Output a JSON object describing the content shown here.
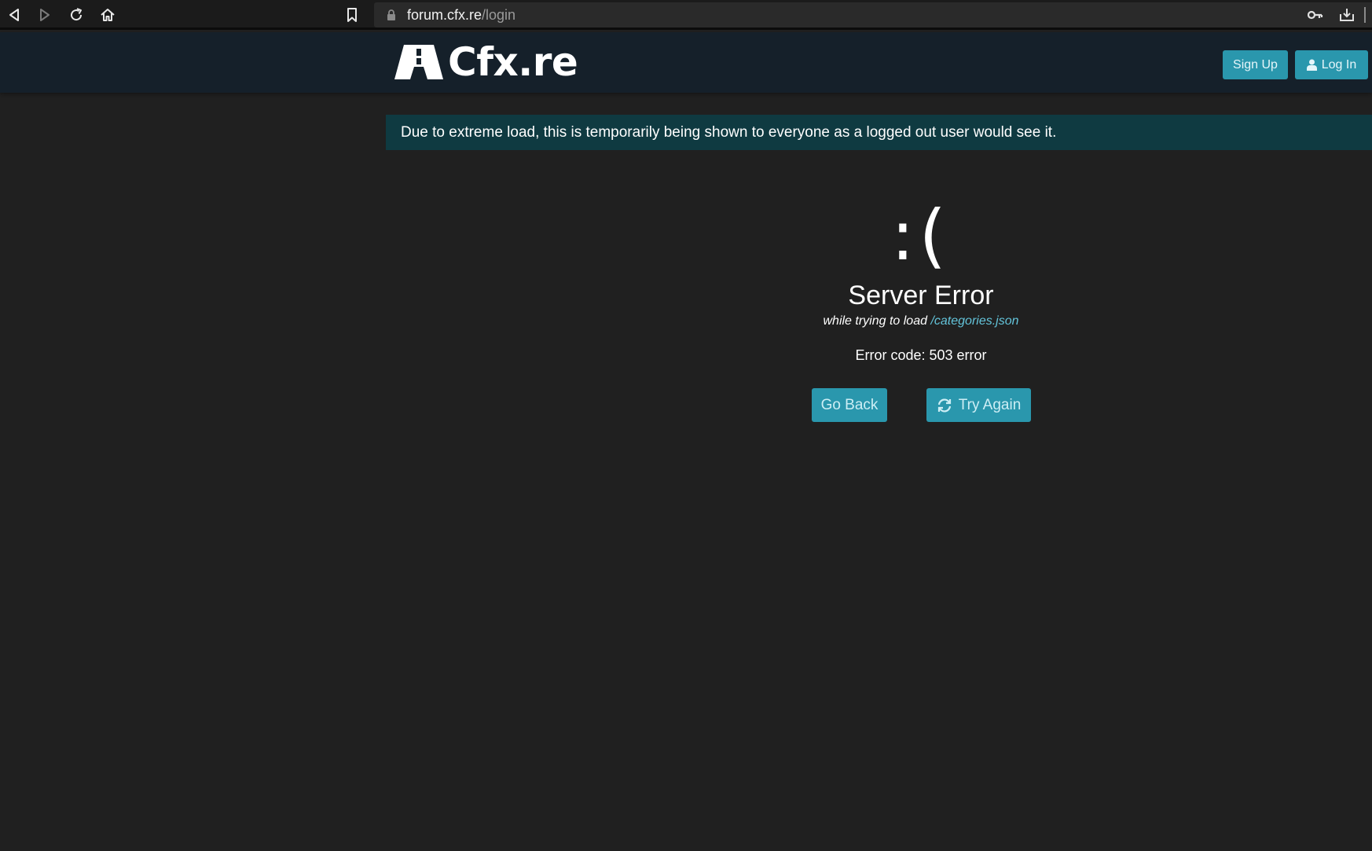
{
  "browser": {
    "url_host": "forum.cfx.re",
    "url_path": "/login",
    "icons": [
      "back-icon",
      "forward-icon",
      "reload-icon",
      "home-icon",
      "bookmark-icon",
      "lock-icon",
      "key-icon",
      "download-icon"
    ]
  },
  "header": {
    "logo_text": "Cfx.re",
    "signup_label": "Sign Up",
    "login_label": "Log In",
    "accent_color": "#2a97ad"
  },
  "banner": {
    "text": "Due to extreme load, this is temporarily being shown to everyone as a logged out user would see it."
  },
  "error": {
    "face": ":(",
    "title": "Server Error",
    "subtitle_prefix": "while trying to load ",
    "subtitle_path": "/categories.json",
    "code_text": "Error code: 503 error",
    "go_back_label": "Go Back",
    "try_again_label": "Try Again"
  }
}
